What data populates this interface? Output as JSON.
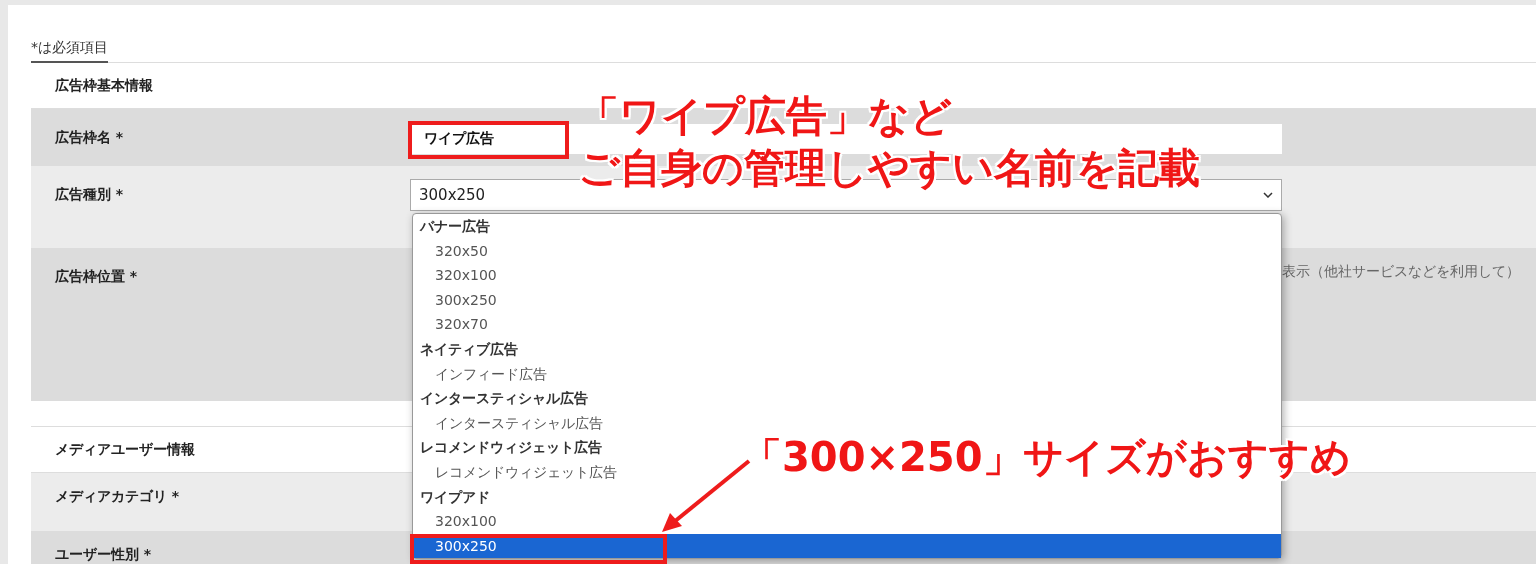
{
  "required_note": "*は必須項目",
  "form_rows": [
    {
      "kind": "section",
      "label": "広告枠基本情報"
    },
    {
      "kind": "text",
      "label": "広告枠名 *",
      "value": "ワイプ広告"
    },
    {
      "kind": "select",
      "label": "広告種別 *",
      "value": "300x250"
    },
    {
      "kind": "note",
      "label": "広告枠位置 *",
      "text": "表示（他社サービスなどを利用して）"
    },
    {
      "kind": "section",
      "label": "メディアユーザー情報"
    },
    {
      "kind": "blank",
      "label": "メディアカテゴリ *"
    },
    {
      "kind": "blank",
      "label": "ユーザー性別 *"
    }
  ],
  "dropdown": {
    "groups": [
      {
        "label": "バナー広告",
        "options": [
          {
            "label": "320x50",
            "selected": false
          },
          {
            "label": "320x100",
            "selected": false
          },
          {
            "label": "300x250",
            "selected": false
          },
          {
            "label": "320x70",
            "selected": false
          }
        ]
      },
      {
        "label": "ネイティブ広告",
        "options": [
          {
            "label": "インフィード広告",
            "selected": false
          }
        ]
      },
      {
        "label": "インタースティシャル広告",
        "options": [
          {
            "label": "インタースティシャル広告",
            "selected": false
          }
        ]
      },
      {
        "label": "レコメンドウィジェット広告",
        "options": [
          {
            "label": "レコメンドウィジェット広告",
            "selected": false
          }
        ]
      },
      {
        "label": "ワイプアド",
        "options": [
          {
            "label": "320x100",
            "selected": false
          },
          {
            "label": "300x250",
            "selected": true
          }
        ]
      }
    ]
  },
  "annotations": [
    {
      "kind": "top",
      "lines": [
        "「ワイプ広告」など",
        "ご自身の管理しやすい名前を記載"
      ]
    },
    {
      "kind": "bottom",
      "lines": [
        "「300×250」サイズがおすすめ"
      ]
    }
  ]
}
